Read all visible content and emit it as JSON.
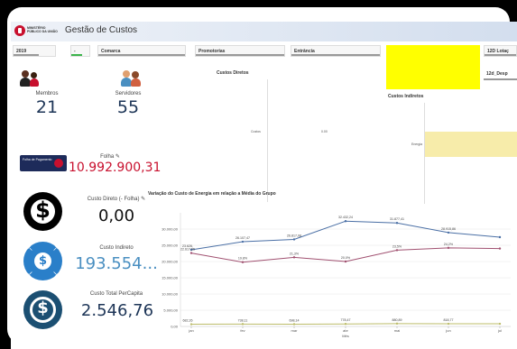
{
  "header": {
    "logo_text": "MINISTÉRIO PÚBLICO DA UNIÃO",
    "title": "Gestão de Custos"
  },
  "filters": [
    {
      "label": "2019"
    },
    {
      "label": "-"
    },
    {
      "label": "Comarca"
    },
    {
      "label": "Promotorias"
    },
    {
      "label": "Entrância"
    },
    {
      "label": "12D Lotaç"
    },
    {
      "label": "12d_Desp"
    }
  ],
  "kpis": {
    "membros": {
      "label": "Membros",
      "value": "21"
    },
    "servidores": {
      "label": "Servidores",
      "value": "55"
    },
    "folha": {
      "label": "Folha",
      "value": "10.992.900,31",
      "badge": "Folha de Pagamento"
    },
    "custo_direto": {
      "label": "Custo Direto (- Folha)",
      "value": "0,00"
    },
    "custo_indireto": {
      "label": "Custo Indireto",
      "value": "193.554..."
    },
    "custo_total": {
      "label": "Custo Total PerCapita",
      "value": "2.546,76"
    }
  },
  "charts": {
    "custos_diretos_title": "Custos Diretos",
    "custos_diretos_label": "Custos",
    "custos_diretos_value": "0.00",
    "custos_indiretos_title": "Custos Indiretos",
    "custos_indiretos_label": "Energia"
  },
  "colors": {
    "accent_red": "#c8102e",
    "dark_navy": "#1d2b5a",
    "icon_blue": "#2a7fc9",
    "icon_dark_teal": "#1b4f72",
    "kpi_blue": "#4a8fc1",
    "series1": "#4a6fa5",
    "series2": "#a05070",
    "series3": "#bcbc6a",
    "energia_fill": "#f7ecaa"
  },
  "chart_data": {
    "type": "line",
    "title": "Variação do Custo de Energia em relação a Média do Grupo",
    "xlabel": "Mês",
    "categories": [
      "jan",
      "fev",
      "mar",
      "abr",
      "mai",
      "jun",
      "jul"
    ],
    "ylim": [
      0,
      35000
    ],
    "yticks": [
      "30.000,00",
      "25.000,00",
      "20.000,00",
      "15.000,00",
      "10.000,00",
      "5.000,00",
      "0,00"
    ],
    "series": [
      {
        "values": [
          23626,
          26107.47,
          26817.08,
          32432.24,
          31877.41,
          28915.86,
          27500
        ],
        "labels": [
          "23.626,",
          "26.107,47",
          "26.817,08",
          "32.432,24",
          "31.877,41",
          "28.915,86",
          ""
        ]
      },
      {
        "values": [
          22617.55,
          19800,
          21300,
          20000,
          23500,
          24200,
          24000
        ],
        "labels": [
          "22.617,55",
          "19.8%",
          "21,3%",
          "20.0%",
          "23,5%",
          "24,2%",
          ""
        ]
      },
      {
        "values": [
          682.26,
          738.11,
          698.14,
          778.47,
          880.89,
          818.77,
          820
        ],
        "labels": [
          "682,26",
          "738,11",
          "698,14",
          "778,47",
          "880,89",
          "818,77",
          ""
        ]
      }
    ]
  }
}
